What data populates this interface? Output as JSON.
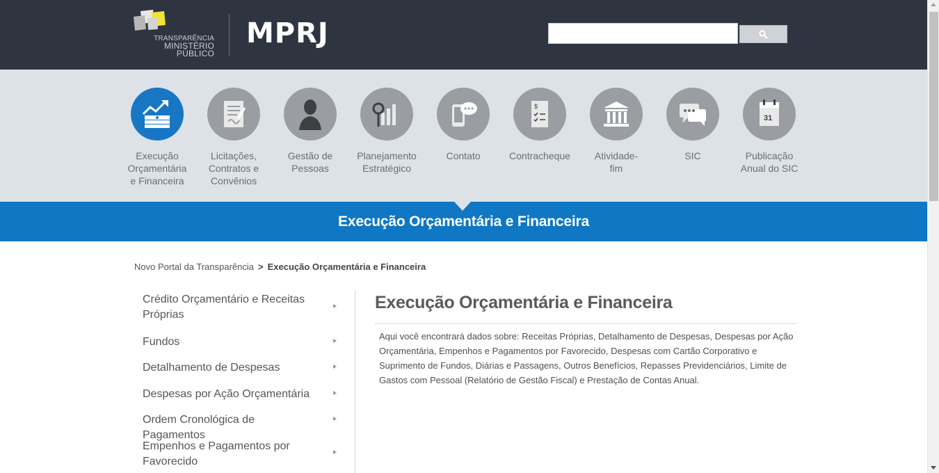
{
  "header": {
    "logo_line1": "TRANSPARÊNCIA",
    "logo_line2": "MINISTÉRIO PÚBLICO",
    "brand": "MPRJ",
    "search": {
      "value": "",
      "button_icon": "search-icon"
    }
  },
  "nav": {
    "items": [
      {
        "lines": [
          "Execução",
          "Orçamentária",
          "e Financeira"
        ],
        "icon": "money-growth-icon",
        "active": true
      },
      {
        "lines": [
          "Licitações,",
          "Contratos e",
          "Convênios"
        ],
        "icon": "contract-document-icon",
        "active": false
      },
      {
        "lines": [
          "Gestão de",
          "Pessoas"
        ],
        "icon": "person-icon",
        "active": false
      },
      {
        "lines": [
          "Planejamento",
          "Estratégico"
        ],
        "icon": "chart-magnifier-icon",
        "active": false
      },
      {
        "lines": [
          "Contato"
        ],
        "icon": "phone-chat-icon",
        "active": false
      },
      {
        "lines": [
          "Contracheque"
        ],
        "icon": "paycheck-icon",
        "active": false
      },
      {
        "lines": [
          "Atividade-",
          "fim"
        ],
        "icon": "courthouse-icon",
        "active": false
      },
      {
        "lines": [
          "SIC"
        ],
        "icon": "chat-bubbles-icon",
        "active": false
      },
      {
        "lines": [
          "Publicação",
          "Anual do SIC"
        ],
        "icon": "calendar-icon",
        "active": false
      }
    ],
    "colors": {
      "active": "#1777c4",
      "inactive": "#9a9ea3"
    }
  },
  "band": {
    "title": "Execução Orçamentária e Financeira",
    "color": "#0f77c3"
  },
  "breadcrumb": {
    "home": "Novo Portal da Transparência",
    "separator": ">",
    "current": "Execução Orçamentária e Financeira"
  },
  "sidebar": {
    "items": [
      "Crédito Orçamentário e Receitas Próprias",
      "Fundos",
      "Detalhamento de Despesas",
      "Despesas por Ação Orçamentária",
      "Ordem Cronológica de Pagamentos",
      "Empenhos e Pagamentos por Favorecido"
    ]
  },
  "content": {
    "title": "Execução Orçamentária e Financeira",
    "text": "Aqui você encontrará dados sobre: Receitas Próprias, Detalhamento de Despesas, Despesas por Ação Orçamentária, Empenhos e Pagamentos por Favorecido, Despesas com Cartão Corporativo e Suprimento de Fundos, Diárias e Passagens, Outros Benefícios, Repasses Previdenciários, Limite de Gastos com Pessoal (Relatório de Gestão Fiscal) e Prestação de Contas Anual."
  }
}
